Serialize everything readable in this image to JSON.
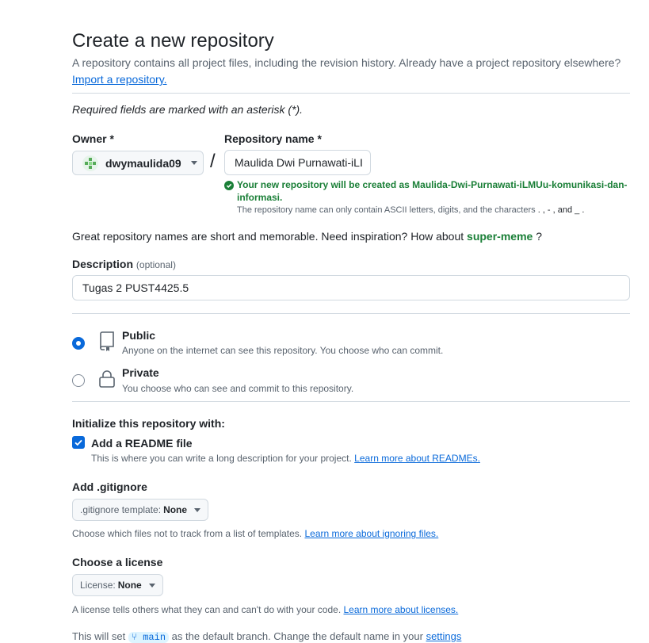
{
  "header": {
    "title": "Create a new repository",
    "subtitle": "A repository contains all project files, including the revision history. Already have a project repository elsewhere?",
    "import_link": "Import a repository."
  },
  "required_note": "Required fields are marked with an asterisk (*).",
  "owner": {
    "label": "Owner *",
    "value": "dwymaulida09"
  },
  "separator": "/",
  "repo_name": {
    "label": "Repository name *",
    "value": "Maulida Dwi Purnawati-iLI",
    "success_line1": "Your new repository will be created as Maulida-Dwi-Purnawati-iLMUu-komunikasi-dan-",
    "success_line2": "informasi.",
    "rule_prefix": "The repository name can only contain ASCII letters, digits, and the characters",
    "rule_chars": ". , - , and _ ."
  },
  "inspiration": {
    "text": "Great repository names are short and memorable. Need inspiration? How about",
    "suggestion": "super-meme",
    "suffix": "?"
  },
  "description": {
    "label": "Description",
    "optional": "(optional)",
    "value": "Tugas 2 PUST4425.5"
  },
  "visibility": {
    "public_title": "Public",
    "public_desc": "Anyone on the internet can see this repository. You choose who can commit.",
    "private_title": "Private",
    "private_desc": "You choose who can see and commit to this repository.",
    "selected": "public"
  },
  "init": {
    "heading": "Initialize this repository with:",
    "readme_label": "Add a README file",
    "readme_desc": "This is where you can write a long description for your project.",
    "readme_link": "Learn more about READMEs.",
    "readme_checked": true
  },
  "gitignore": {
    "heading": "Add .gitignore",
    "select_prefix": ".gitignore template:",
    "select_value": "None",
    "desc": "Choose which files not to track from a list of templates.",
    "link": "Learn more about ignoring files."
  },
  "license": {
    "heading": "Choose a license",
    "select_prefix": "License:",
    "select_value": "None",
    "desc": "A license tells others what they can and can't do with your code.",
    "link": "Learn more about licenses."
  },
  "branch_note": {
    "prefix": "This will set",
    "branch": "main",
    "middle": "as the default branch. Change the default name in your",
    "link": "settings"
  },
  "colors": {
    "accent": "#0969da",
    "success": "#1a7f37",
    "muted": "#59636e"
  }
}
